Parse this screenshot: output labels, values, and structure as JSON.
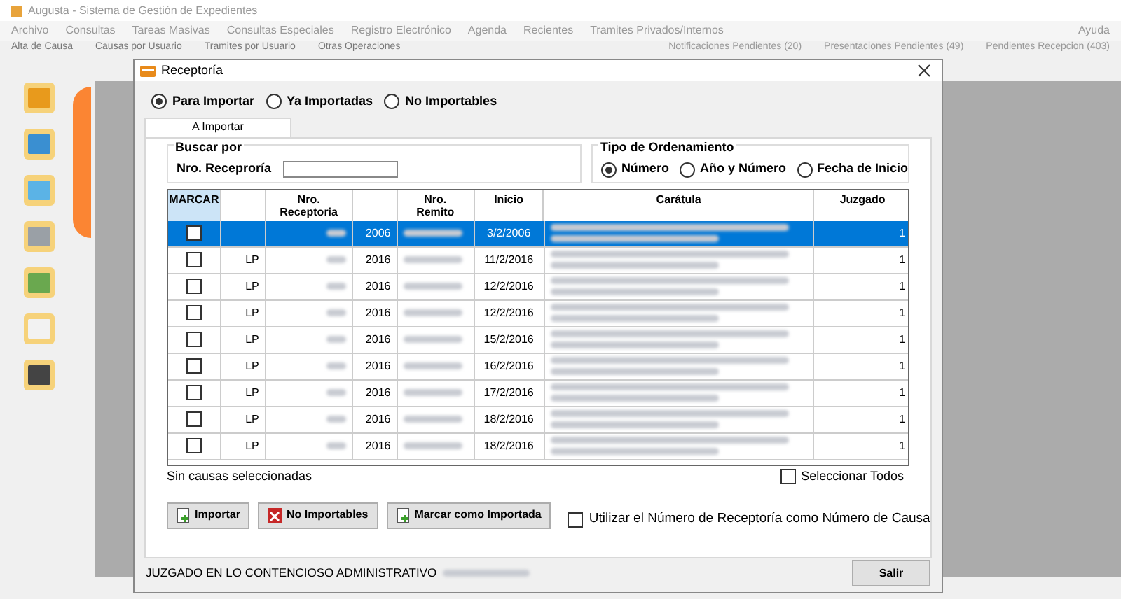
{
  "app": {
    "title": "Augusta - Sistema de Gestión de Expedientes",
    "menu": [
      "Archivo",
      "Consultas",
      "Tareas Masivas",
      "Consultas Especiales",
      "Registro Electrónico",
      "Agenda",
      "Recientes",
      "Tramites Privados/Internos"
    ],
    "help_menu": "Ayuda",
    "toolbar_tabs": [
      "Alta de Causa",
      "Causas por Usuario",
      "Tramites por Usuario",
      "Otras Operaciones"
    ],
    "notifications": [
      "Notificaciones Pendientes (20)",
      "Presentaciones Pendientes (49)",
      "Pendientes Recepcion (403)"
    ]
  },
  "dialog": {
    "title": "Receptoría",
    "filter_options": [
      {
        "label": "Para Importar",
        "selected": true
      },
      {
        "label": "Ya Importadas",
        "selected": false
      },
      {
        "label": "No Importables",
        "selected": false
      }
    ],
    "tab": "A Importar",
    "search": {
      "title": "Buscar por",
      "label": "Nro. Receproría"
    },
    "ordering": {
      "title": "Tipo de Ordenamiento",
      "options": [
        {
          "label": "Número",
          "selected": true
        },
        {
          "label": "Año y Número",
          "selected": false
        },
        {
          "label": "Fecha de Inicio",
          "selected": false
        }
      ]
    },
    "table": {
      "columns": [
        {
          "kind": "text",
          "label": "MARCAR",
          "selected": true
        },
        {
          "kind": "blank"
        },
        {
          "kind": "text",
          "label": "Nro.\nReceptoria",
          "selected": false
        },
        {
          "kind": "blank"
        },
        {
          "kind": "text",
          "label": "Nro.\nRemito",
          "selected": false
        },
        {
          "kind": "text",
          "label": "Inicio",
          "selected": false
        },
        {
          "kind": "text",
          "label": "Carátula",
          "selected": false
        },
        {
          "kind": "text",
          "label": "Juzgado",
          "selected": false
        }
      ],
      "rows": [
        {
          "selected": true,
          "checked": false,
          "year": "2006",
          "inicio": "3/2/2006",
          "juzgado": "1"
        },
        {
          "selected": false,
          "checked": false,
          "column_2": "LP",
          "year": "2016",
          "inicio": "11/2/2016",
          "juzgado": "1"
        },
        {
          "selected": false,
          "checked": false,
          "column_2": "LP",
          "year": "2016",
          "inicio": "12/2/2016",
          "juzgado": "1"
        },
        {
          "selected": false,
          "checked": false,
          "column_2": "LP",
          "year": "2016",
          "inicio": "12/2/2016",
          "juzgado": "1"
        },
        {
          "selected": false,
          "checked": false,
          "column_2": "LP",
          "year": "2016",
          "inicio": "15/2/2016",
          "juzgado": "1"
        },
        {
          "selected": false,
          "checked": false,
          "column_2": "LP",
          "year": "2016",
          "inicio": "16/2/2016",
          "juzgado": "1"
        },
        {
          "selected": false,
          "checked": false,
          "column_2": "LP",
          "year": "2016",
          "inicio": "17/2/2016",
          "juzgado": "1"
        },
        {
          "selected": false,
          "checked": false,
          "column_2": "LP",
          "year": "2016",
          "inicio": "18/2/2016",
          "juzgado": "1"
        },
        {
          "selected": false,
          "checked": false,
          "column_2": "LP",
          "year": "2016",
          "inicio": "18/2/2016",
          "juzgado": "1"
        }
      ]
    },
    "selection_status": "Sin causas seleccionadas",
    "select_all": {
      "label": "Seleccionar Todos",
      "checked": false
    },
    "buttons": [
      {
        "kind": "import",
        "label": "Importar"
      },
      {
        "kind": "reject",
        "label": "No Importables"
      },
      {
        "kind": "import",
        "label": "Marcar como Importada"
      }
    ],
    "use_number": {
      "label": "Utilizar el Número de Receptoría como Número de Causa",
      "checked": false
    },
    "court": "JUZGADO EN LO CONTENCIOSO ADMINISTRATIVO",
    "exit_button": "Salir"
  }
}
